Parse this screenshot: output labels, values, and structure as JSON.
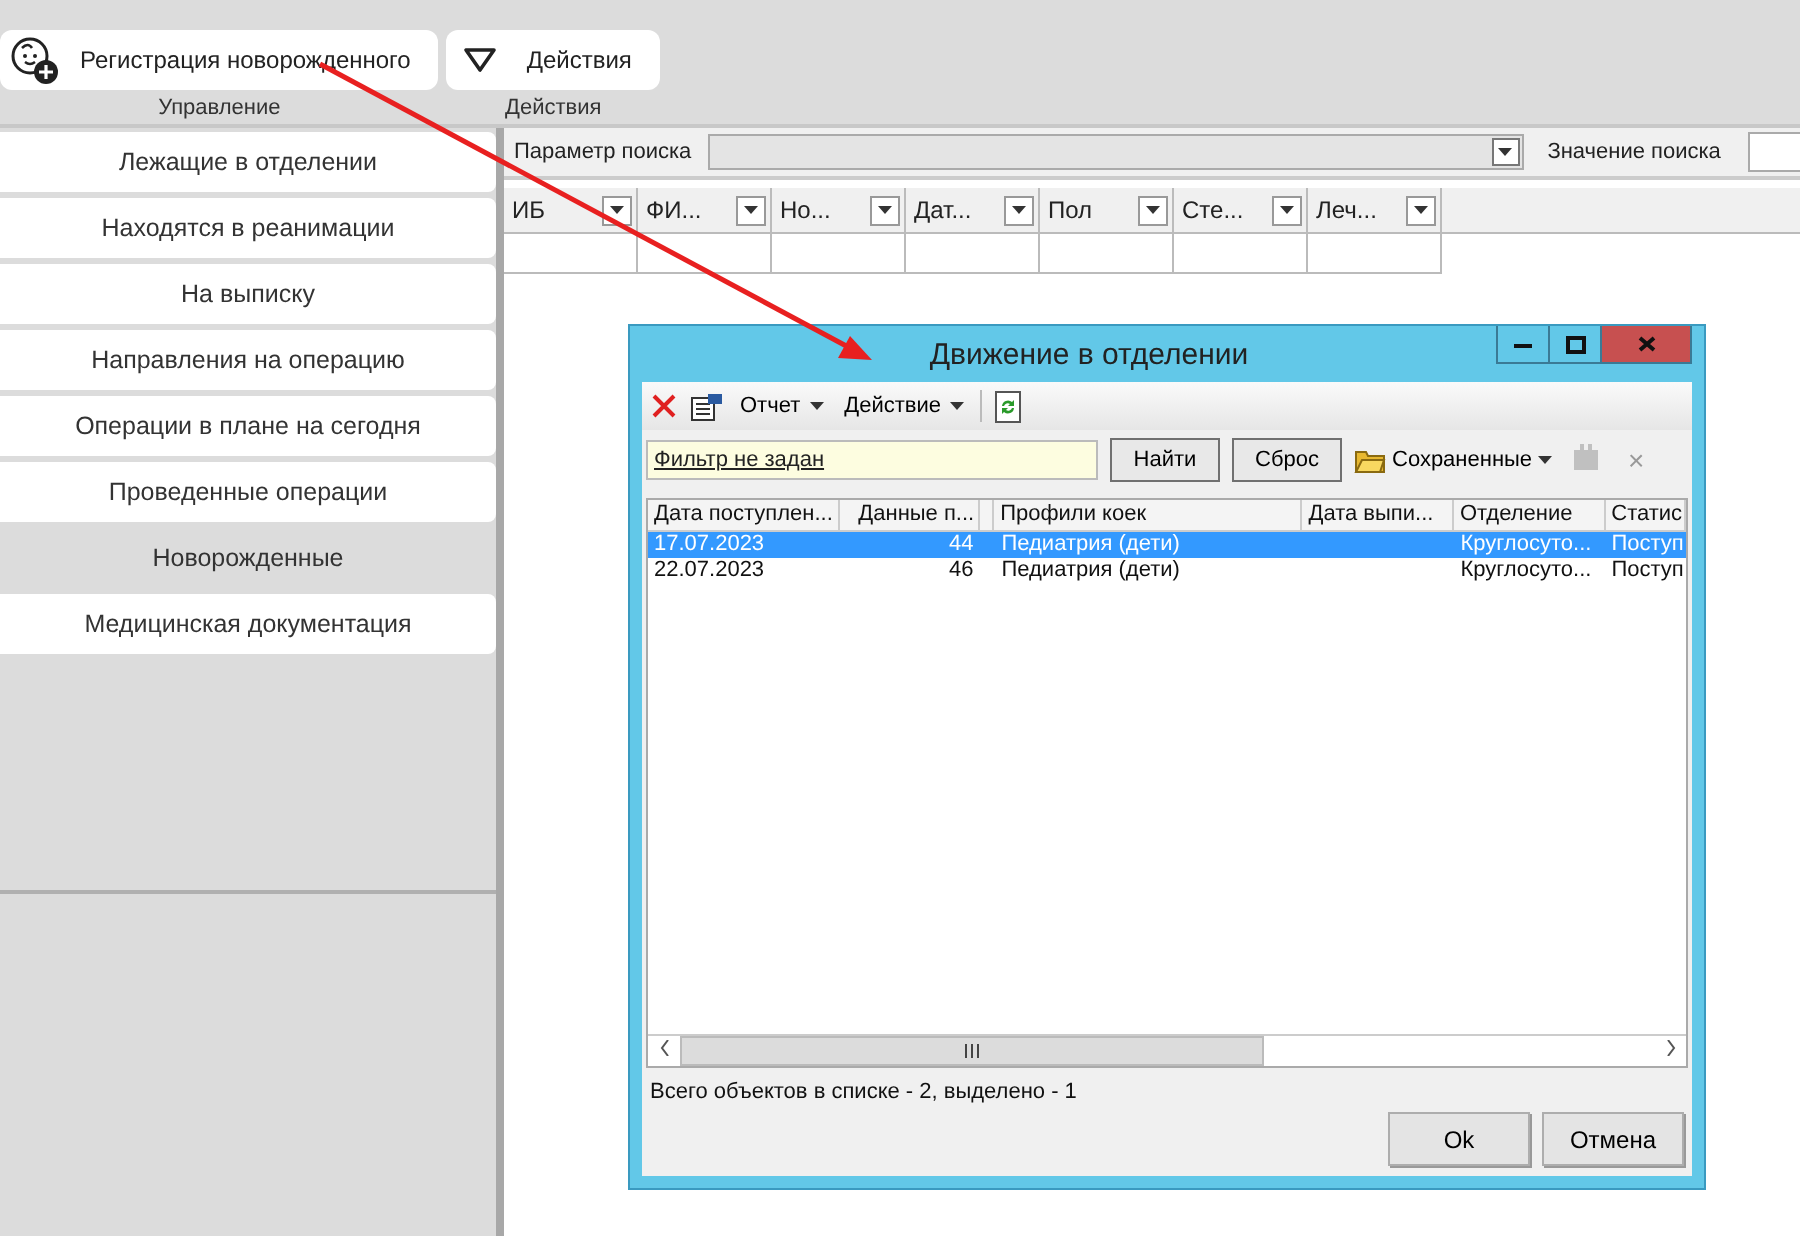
{
  "ribbon": {
    "groups": [
      {
        "label": "Управление",
        "buttons": [
          {
            "label": "Регистрация новорожденного",
            "kind": "register"
          }
        ]
      },
      {
        "label": "Действия",
        "buttons": [
          {
            "label": "Действия",
            "kind": "actions"
          }
        ]
      }
    ]
  },
  "sidebar": {
    "items": [
      {
        "label": "Лежащие в отделении",
        "selected": false
      },
      {
        "label": "Находятся в реанимации",
        "selected": false
      },
      {
        "label": "На выписку",
        "selected": false
      },
      {
        "label": "Направления на операцию",
        "selected": false
      },
      {
        "label": "Операции в плане на сегодня",
        "selected": false
      },
      {
        "label": "Проведенные операции",
        "selected": false
      },
      {
        "label": "Новорожденные",
        "selected": true
      },
      {
        "label": "Медицинская документация",
        "selected": false
      }
    ]
  },
  "search": {
    "parameter_label": "Параметр поиска",
    "value_label": "Значение поиска"
  },
  "table": {
    "columns": [
      "ИБ",
      "ФИ...",
      "Но...",
      "Дат...",
      "Пол",
      "Сте...",
      "Леч..."
    ]
  },
  "dialog": {
    "title": "Движение в отделении",
    "toolbar": [
      {
        "kind": "delete"
      },
      {
        "kind": "properties"
      },
      {
        "kind": "menu",
        "label": "Отчет"
      },
      {
        "kind": "menu",
        "label": "Действие"
      },
      {
        "kind": "separator"
      },
      {
        "kind": "refresh"
      }
    ],
    "filter": {
      "link": "Фильтр не задан",
      "find": "Найти",
      "reset": "Сброс",
      "saved": "Сохраненные",
      "save_disabled": true,
      "clear": "×"
    },
    "columns": [
      "Дата поступлен...",
      "Данные п...",
      "Профили коек",
      "Дата выпи...",
      "Отделение",
      "Статис"
    ],
    "rows": [
      {
        "admitted": "17.07.2023",
        "data": "44",
        "profile": "Педиатрия (дети)",
        "department": "Круглосуто...",
        "status": "Поступ",
        "selected": true
      },
      {
        "admitted": "22.07.2023",
        "data": "46",
        "profile": "Педиатрия (дети)",
        "department": "Круглосуто...",
        "status": "Поступ",
        "selected": false
      }
    ],
    "status": "Всего объектов в списке - 2, выделено - 1",
    "buttons": [
      "Ok",
      "Отмена"
    ]
  }
}
